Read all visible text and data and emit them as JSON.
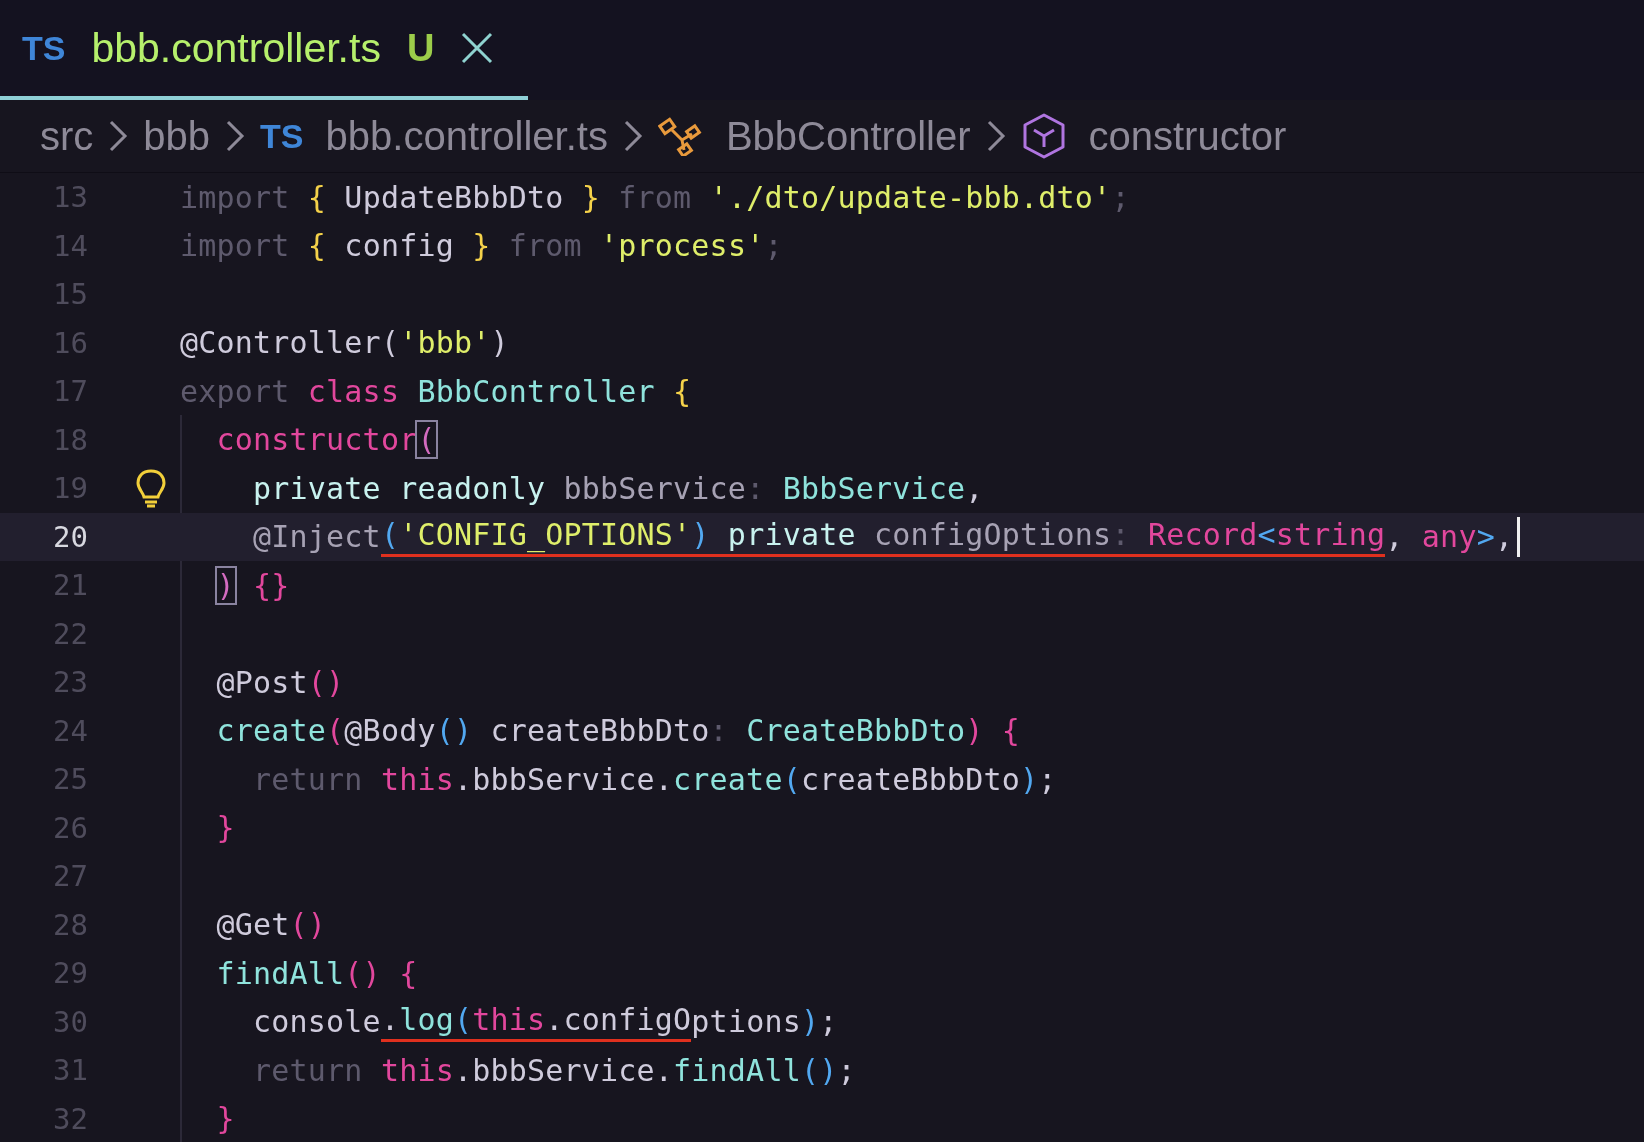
{
  "tab": {
    "badge": "TS",
    "title": "bbb.controller.ts",
    "status": "U",
    "selected": true
  },
  "breadcrumbs": [
    {
      "label": "src",
      "kind": "folder"
    },
    {
      "label": "bbb",
      "kind": "folder"
    },
    {
      "label": "bbb.controller.ts",
      "kind": "file",
      "badge": "TS"
    },
    {
      "label": "BbbController",
      "kind": "class"
    },
    {
      "label": "constructor",
      "kind": "method"
    }
  ],
  "lines": [
    {
      "number": "13",
      "active": false,
      "tokens": [
        {
          "t": "import",
          "kind": "dim"
        },
        {
          "t": " {",
          "kind": "brace"
        },
        {
          "t": " UpdateBbbDto ",
          "kind": "ident"
        },
        {
          "t": "}",
          "kind": "brace"
        },
        {
          "t": " from ",
          "kind": "dim"
        },
        {
          "t": "'./dto/update-bbb.dto'",
          "kind": "string"
        },
        {
          "t": ";",
          "kind": "dim"
        }
      ]
    },
    {
      "number": "14",
      "active": false,
      "tokens": [
        {
          "t": "import",
          "kind": "dim"
        },
        {
          "t": " {",
          "kind": "brace"
        },
        {
          "t": " config ",
          "kind": "ident"
        },
        {
          "t": "}",
          "kind": "brace"
        },
        {
          "t": " from ",
          "kind": "dim"
        },
        {
          "t": "'process'",
          "kind": "string"
        },
        {
          "t": ";",
          "kind": "dim"
        }
      ]
    },
    {
      "number": "15",
      "active": false
    },
    {
      "number": "16",
      "active": false,
      "tokens": [
        {
          "t": "@Controller(",
          "kind": "ident"
        },
        {
          "t": "'bbb'",
          "kind": "string"
        },
        {
          "t": ")",
          "kind": "ident"
        }
      ]
    },
    {
      "number": "17",
      "active": false,
      "tokens": [
        {
          "t": "export",
          "kind": "dim"
        },
        {
          "t": " class",
          "kind": "pink"
        },
        {
          "t": " BbbController",
          "kind": "type"
        },
        {
          "t": " {",
          "kind": "brace"
        }
      ]
    },
    {
      "number": "18",
      "active": false,
      "tokens": [
        {
          "t": "  constructor",
          "kind": "pink"
        },
        {
          "t": "(",
          "kind": "match"
        }
      ]
    },
    {
      "number": "19",
      "active": false,
      "hint": true,
      "tokens": [
        {
          "t": "    private readonly",
          "kind": "modifier"
        },
        {
          "t": " bbbService",
          "kind": "prop"
        },
        {
          "t": ":",
          "kind": "dim"
        },
        {
          "t": " BbbService",
          "kind": "type"
        },
        {
          "t": ",",
          "kind": "ident"
        }
      ]
    },
    {
      "number": "20",
      "active": true,
      "tokens": [
        {
          "t": "    @Inject",
          "kind": "prop"
        },
        {
          "t": "(",
          "kind": "blue",
          "marked": true
        },
        {
          "t": "'CONFIG_OPTIONS'",
          "kind": "string",
          "marked": true
        },
        {
          "t": ")",
          "kind": "blue",
          "marked": true
        },
        {
          "t": " private",
          "kind": "modifier",
          "marked": true
        },
        {
          "t": " configOptions",
          "kind": "prop",
          "marked": true
        },
        {
          "t": ":",
          "kind": "dim",
          "marked": true
        },
        {
          "t": " Record",
          "kind": "pink",
          "marked": true
        },
        {
          "t": "<",
          "kind": "blue",
          "marked": true
        },
        {
          "t": "string",
          "kind": "pink",
          "marked": true
        },
        {
          "t": ", ",
          "kind": "ident"
        },
        {
          "t": "any",
          "kind": "pink"
        },
        {
          "t": ">",
          "kind": "blue"
        },
        {
          "t": ",",
          "kind": "ident"
        }
      ]
    },
    {
      "number": "21",
      "active": false,
      "tokens": [
        {
          "t": "  )",
          "kind": "match"
        },
        {
          "t": " {}",
          "kind": "pink"
        }
      ]
    },
    {
      "number": "22",
      "active": false
    },
    {
      "number": "23",
      "active": false,
      "tokens": [
        {
          "t": "  @Post",
          "kind": "ident"
        },
        {
          "t": "()",
          "kind": "pink"
        }
      ]
    },
    {
      "number": "24",
      "active": false,
      "tokens": [
        {
          "t": "  create",
          "kind": "type"
        },
        {
          "t": "(",
          "kind": "pink"
        },
        {
          "t": "@Body",
          "kind": "ident"
        },
        {
          "t": "()",
          "kind": "blue"
        },
        {
          "t": " createBbbDto",
          "kind": "ident"
        },
        {
          "t": ":",
          "kind": "dim"
        },
        {
          "t": " CreateBbbDto",
          "kind": "type"
        },
        {
          "t": ")",
          "kind": "pink"
        },
        {
          "t": " {",
          "kind": "pink"
        }
      ]
    },
    {
      "number": "25",
      "active": false,
      "tokens": [
        {
          "t": "    return",
          "kind": "dim"
        },
        {
          "t": " this",
          "kind": "pink"
        },
        {
          "t": ".bbbService.",
          "kind": "ident"
        },
        {
          "t": "create",
          "kind": "type"
        },
        {
          "t": "(",
          "kind": "blue"
        },
        {
          "t": "createBbbDto",
          "kind": "ident"
        },
        {
          "t": ")",
          "kind": "blue"
        },
        {
          "t": ";",
          "kind": "ident"
        }
      ]
    },
    {
      "number": "26",
      "active": false,
      "tokens": [
        {
          "t": "  }",
          "kind": "pink"
        }
      ]
    },
    {
      "number": "27",
      "active": false
    },
    {
      "number": "28",
      "active": false,
      "tokens": [
        {
          "t": "  @Get",
          "kind": "ident"
        },
        {
          "t": "()",
          "kind": "pink"
        }
      ]
    },
    {
      "number": "29",
      "active": false,
      "tokens": [
        {
          "t": "  findAll",
          "kind": "type"
        },
        {
          "t": "()",
          "kind": "pink"
        },
        {
          "t": " {",
          "kind": "pink"
        }
      ]
    },
    {
      "number": "30",
      "active": false,
      "tokens": [
        {
          "t": "    console",
          "kind": "ident"
        },
        {
          "t": ".",
          "kind": "ident",
          "marked": true
        },
        {
          "t": "log",
          "kind": "type",
          "marked": true
        },
        {
          "t": "(",
          "kind": "blue",
          "marked": true
        },
        {
          "t": "this",
          "kind": "pink",
          "marked": true
        },
        {
          "t": ".configO",
          "kind": "ident",
          "marked": true
        },
        {
          "t": "ptions",
          "kind": "ident"
        },
        {
          "t": ")",
          "kind": "blue"
        },
        {
          "t": ";",
          "kind": "ident"
        }
      ]
    },
    {
      "number": "31",
      "active": false,
      "tokens": [
        {
          "t": "    return",
          "kind": "dim"
        },
        {
          "t": " this",
          "kind": "pink"
        },
        {
          "t": ".bbbService.",
          "kind": "ident"
        },
        {
          "t": "findAll",
          "kind": "type"
        },
        {
          "t": "()",
          "kind": "blue"
        },
        {
          "t": ";",
          "kind": "ident"
        }
      ]
    },
    {
      "number": "32",
      "active": false,
      "tokens": [
        {
          "t": "  }",
          "kind": "pink"
        }
      ]
    }
  ]
}
